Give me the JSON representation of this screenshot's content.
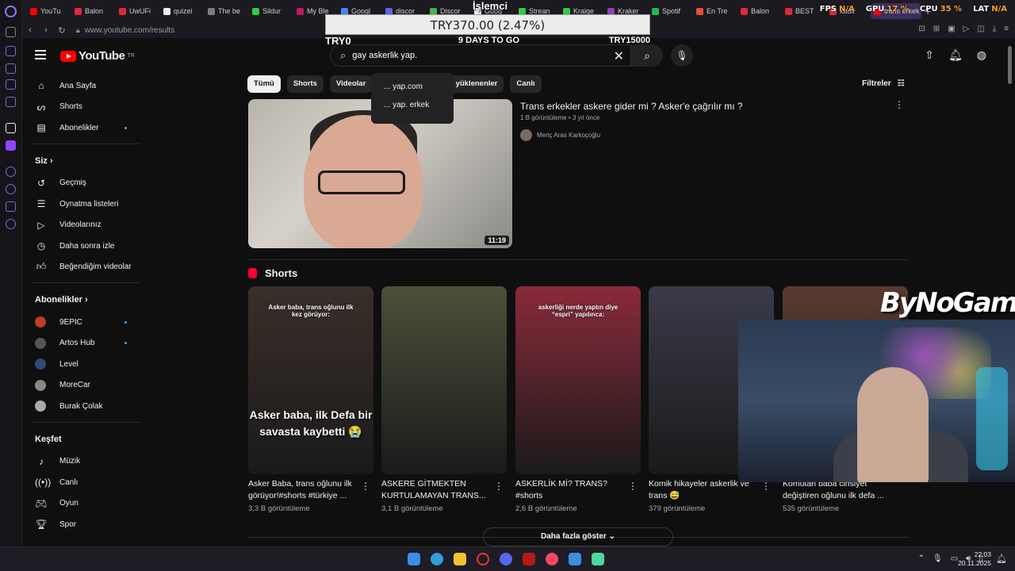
{
  "browser": {
    "tabs": [
      "YouTu",
      "Balon",
      "UwUFi",
      "quizei",
      "The be",
      "Sildur",
      "My Ble",
      "Googl",
      "discor",
      "Discor",
      "Goog",
      "Strean",
      "Kraige",
      "Kraker",
      "Spotif",
      "En Tre",
      "Balon",
      "BEST",
      "kadir",
      "trans erkek"
    ],
    "url": "www.youtube.com/results"
  },
  "hud": {
    "fps_label": "FPS",
    "fps": "N/A",
    "gpu_label": "GPU",
    "gpu": "17 %",
    "cpu_label": "CPU",
    "cpu": "35 %",
    "lat_label": "LAT",
    "lat": "N/A"
  },
  "donation": {
    "label": "İşlemci",
    "amount": "TRY370.00 (2.47%)",
    "start": "TRY0",
    "days": "9 DAYS TO GO",
    "goal": "TRY15000"
  },
  "youtube": {
    "logo_text": "YouTube",
    "logo_region": "TR",
    "search_value": "gay askerlik yap.",
    "suggestions": [
      "... yap.com",
      "... yap. erkek"
    ]
  },
  "sidebar": {
    "main": [
      {
        "label": "Ana Sayfa",
        "icon": "home-icon"
      },
      {
        "label": "Shorts",
        "icon": "shorts-icon"
      },
      {
        "label": "Abonelikler",
        "icon": "subscriptions-icon"
      }
    ],
    "you_header": "Siz",
    "you": [
      {
        "label": "Geçmiş",
        "icon": "history-icon"
      },
      {
        "label": "Oynatma listeleri",
        "icon": "playlist-icon"
      },
      {
        "label": "Videolarınız",
        "icon": "video-icon"
      },
      {
        "label": "Daha sonra izle",
        "icon": "clock-icon"
      },
      {
        "label": "Beğendiğim videolar",
        "icon": "like-icon"
      }
    ],
    "subs_header": "Abonelikler",
    "subs": [
      {
        "label": "9EPIC",
        "color": "#c0392b"
      },
      {
        "label": "Artos Hub",
        "color": "#555555"
      },
      {
        "label": "Level",
        "color": "#2b4a7a"
      },
      {
        "label": "MoreCar",
        "color": "#888888"
      },
      {
        "label": "Burak Çolak",
        "color": "#aaaaaa"
      }
    ],
    "explore_header": "Keşfet",
    "explore": [
      {
        "label": "Müzik",
        "icon": "music-icon"
      },
      {
        "label": "Canlı",
        "icon": "live-icon"
      },
      {
        "label": "Oyun",
        "icon": "gaming-icon"
      },
      {
        "label": "Spor",
        "icon": "trophy-icon"
      }
    ]
  },
  "chips": [
    "Tümü",
    "Shorts",
    "Videolar",
    "",
    "enler",
    "Son yüklenenler",
    "Canlı"
  ],
  "filters_label": "Filtreler",
  "top_result": {
    "title": "Trans erkekler askere gider mi ? Asker'e çağrılır mı ?",
    "meta": "1 B görüntüleme • 3 yıl önce",
    "channel": "Meriç Aras Karkoçoğlu",
    "duration": "11:19"
  },
  "shorts_header": "Shorts",
  "shorts": [
    {
      "caption": "Asker baba, trans oğlunu ilk kez görüyor:",
      "big": "Asker baba, ilk Defa bir savasta kaybetti 😭",
      "title": "Asker Baba, trans oğlunu ilk görüyor!#shorts #türkiye ...",
      "views": "3,3 B görüntüleme",
      "color": "#3a2f2a"
    },
    {
      "caption": "",
      "big": "",
      "title": "ASKERE GİTMEKTEN KURTULAMAYAN TRANS...",
      "views": "3,1 B görüntüleme",
      "color": "#4a5038"
    },
    {
      "caption": "askerliği nerde yaptın diye “espri” yapılınca:",
      "big": "",
      "title": "ASKERLİK Mİ? TRANS? #shorts",
      "views": "2,6 B görüntüleme",
      "color": "#8a2a3a"
    },
    {
      "caption": "",
      "big": "",
      "title": "Komik hikayeler askerlik ve trans 😅",
      "views": "379 görüntüleme",
      "color": "#3a3a4a"
    },
    {
      "caption": "",
      "big": "",
      "title": "Komutan baba cinsiyet değiştiren oğlunu ilk defa ...",
      "views": "535 görüntüleme",
      "color": "#5a3a30"
    }
  ],
  "show_more": "Daha fazla göster",
  "brand": "ByNoGame",
  "taskbar": {
    "time": "22:03",
    "date": "20.11.2025"
  }
}
